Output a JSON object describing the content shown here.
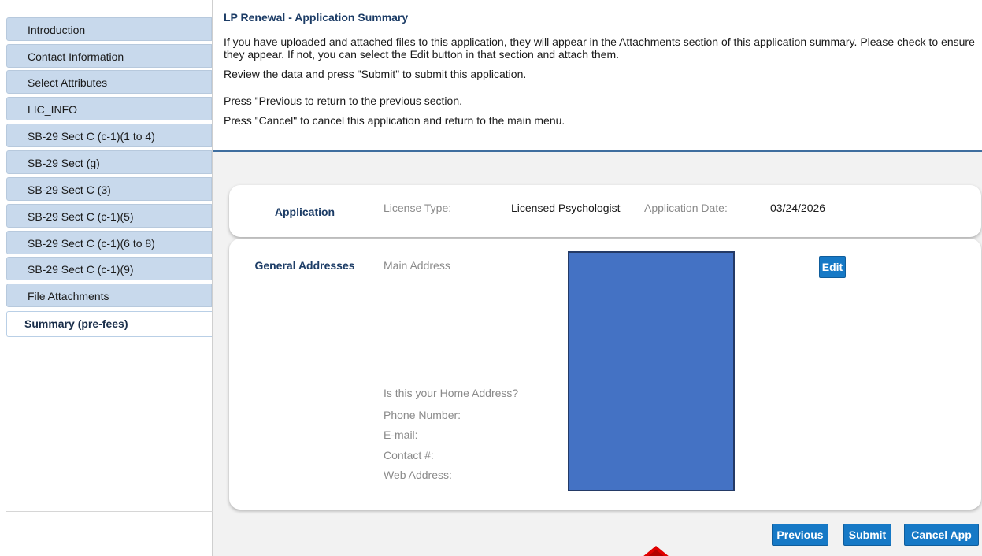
{
  "sidebar": {
    "items": [
      {
        "label": "Introduction"
      },
      {
        "label": "Contact Information"
      },
      {
        "label": "Select Attributes"
      },
      {
        "label": "LIC_INFO"
      },
      {
        "label": "SB-29 Sect C (c-1)(1 to 4)"
      },
      {
        "label": "SB-29 Sect (g)"
      },
      {
        "label": "SB-29 Sect C (3)"
      },
      {
        "label": "SB-29 Sect C (c-1)(5)"
      },
      {
        "label": "SB-29 Sect C (c-1)(6 to 8)"
      },
      {
        "label": "SB-29 Sect C (c-1)(9)"
      },
      {
        "label": "File Attachments"
      },
      {
        "label": "Summary (pre-fees)",
        "active": true
      }
    ]
  },
  "header": {
    "title": "LP Renewal - Application Summary",
    "para1": "If you have uploaded and attached files to this application, they will appear in the Attachments section of this application summary. Please check to ensure they appear. If not, you can select the Edit button in that section and attach them.",
    "para2": "Review the data and press \"Submit\" to submit this application.",
    "para3": "Press \"Previous to return to the previous section.",
    "para4": "Press \"Cancel\" to cancel this application and return to the main menu."
  },
  "application": {
    "section_title": "Application",
    "license_type_label": "License Type:",
    "license_type_value": "Licensed Psychologist",
    "application_date_label": "Application Date:",
    "application_date_value": "03/24/2026"
  },
  "addresses": {
    "section_title": "General Addresses",
    "main_address_label": "Main Address",
    "home_address_label": "Is this your Home Address?",
    "phone_label": "Phone Number:",
    "email_label": "E-mail:",
    "contact_label": "Contact #:",
    "web_label": "Web Address:",
    "edit_label": "Edit",
    "redaction_color": "#4472c4"
  },
  "buttons": {
    "previous": "Previous",
    "submit": "Submit",
    "cancel": "Cancel App"
  },
  "colors": {
    "button_blue": "#1679c6",
    "nav_bg": "#c8d9ec",
    "header_rule": "#3f6e9f",
    "annotation_arrow": "#e00000"
  }
}
